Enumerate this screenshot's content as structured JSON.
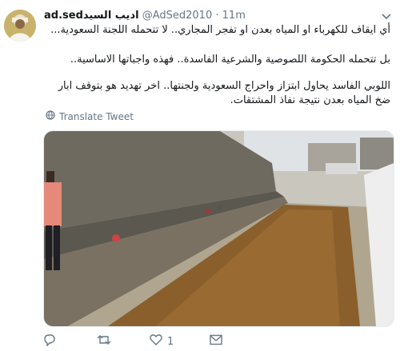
{
  "author": {
    "name": "ad.sedاديب السيد",
    "handle": "@AdSed2010",
    "separator": "·",
    "time": "11m"
  },
  "tweet": {
    "line1": "أي ايقاف للكهرباء او المياه بعدن او تفجر المجاري.. لا تتحمله اللجنة السعودية...",
    "line2": "بل تتحمله الحكومة اللصوصية والشرعية الفاسدة.. فهذه واجباتها الاساسية..",
    "line3": "اللوبي الفاسد يحاول ابتزاز واحراج السعودية ولجنتها.. اخر تهديد هو بتوقف ابار ضخ المياه بعدن نتيجة نفاذ المشتقات."
  },
  "translate_label": "Translate Tweet",
  "actions": {
    "reply_count": "",
    "retweet_count": "",
    "like_count": "1",
    "mail_label": ""
  },
  "icons": [
    "avatar",
    "chevron-down-icon",
    "globe-icon",
    "reply-icon",
    "retweet-icon",
    "like-icon",
    "direct-message-icon"
  ],
  "colors": {
    "text": "#14171a",
    "muted": "#657786"
  }
}
